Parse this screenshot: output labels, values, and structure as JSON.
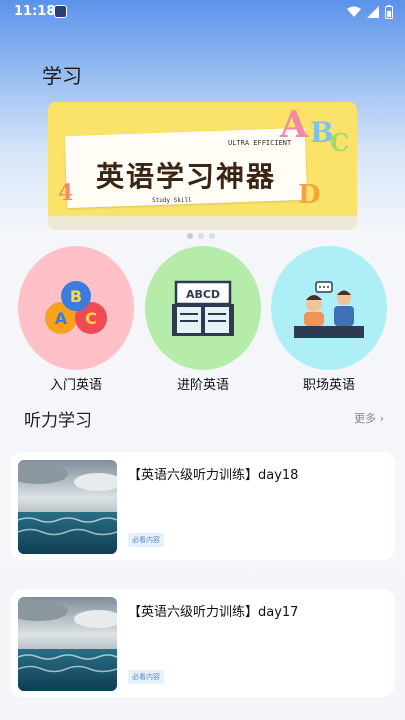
{
  "status_bar": {
    "time": "11:18",
    "icons": [
      "app-icon",
      "wifi-icon",
      "signal-icon",
      "battery-icon"
    ]
  },
  "page_title": "学习",
  "banner": {
    "main_text": "英语学习神器",
    "sub_text_1": "ULTRA EFFICIENT",
    "sub_text_2": "Study Skill",
    "letters": [
      "A",
      "B",
      "C",
      "D",
      "4"
    ],
    "active_dot": 0,
    "dot_count": 3
  },
  "categories": [
    {
      "label": "入门英语",
      "color": "#ffc0c7",
      "icon": "abc-balloons-icon"
    },
    {
      "label": "进阶英语",
      "color": "#b5ecaa",
      "icon": "book-icon"
    },
    {
      "label": "职场英语",
      "color": "#aeeff7",
      "icon": "office-workers-icon"
    }
  ],
  "section": {
    "title": "听力学习",
    "more_label": "更多"
  },
  "cards": [
    {
      "title": "【英语六级听力训练】day18",
      "tag": "必看内容"
    },
    {
      "title": "【英语六级听力训练】day17",
      "tag": "必看内容"
    }
  ],
  "colors": {
    "background_top": "#5b93ea",
    "banner_yellow": "#fbe36a",
    "tag_text": "#5a89c9"
  }
}
